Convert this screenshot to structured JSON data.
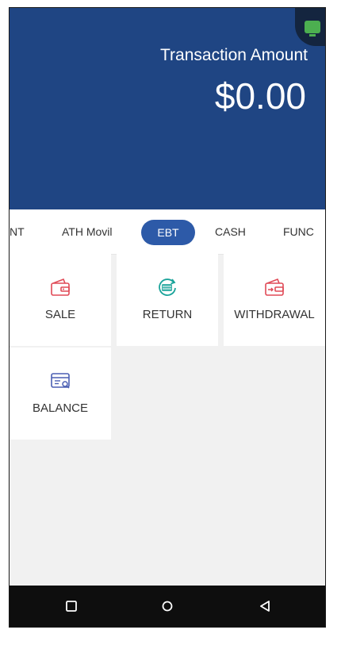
{
  "header": {
    "title": "Transaction Amount",
    "amount": "$0.00",
    "status_icon": "terminal-status-icon"
  },
  "tabs": [
    {
      "label": "NT"
    },
    {
      "label": "ATH Movil"
    },
    {
      "label": "EBT",
      "active": true
    },
    {
      "label": "CASH"
    },
    {
      "label": "FUNC"
    }
  ],
  "actions": [
    {
      "label": "SALE",
      "icon": "wallet-icon"
    },
    {
      "label": "RETURN",
      "icon": "refund-icon"
    },
    {
      "label": "WITHDRAWAL",
      "icon": "withdrawal-icon"
    },
    {
      "label": "BALANCE",
      "icon": "balance-card-icon"
    }
  ],
  "nav": {
    "recents": "square-icon",
    "home": "circle-icon",
    "back": "triangle-back-icon"
  },
  "colors": {
    "header_bg": "#1f4583",
    "active_tab": "#2d5aa8",
    "icon_red": "#e04a57",
    "icon_teal": "#1aa39a",
    "icon_blue": "#4b5fb3"
  }
}
